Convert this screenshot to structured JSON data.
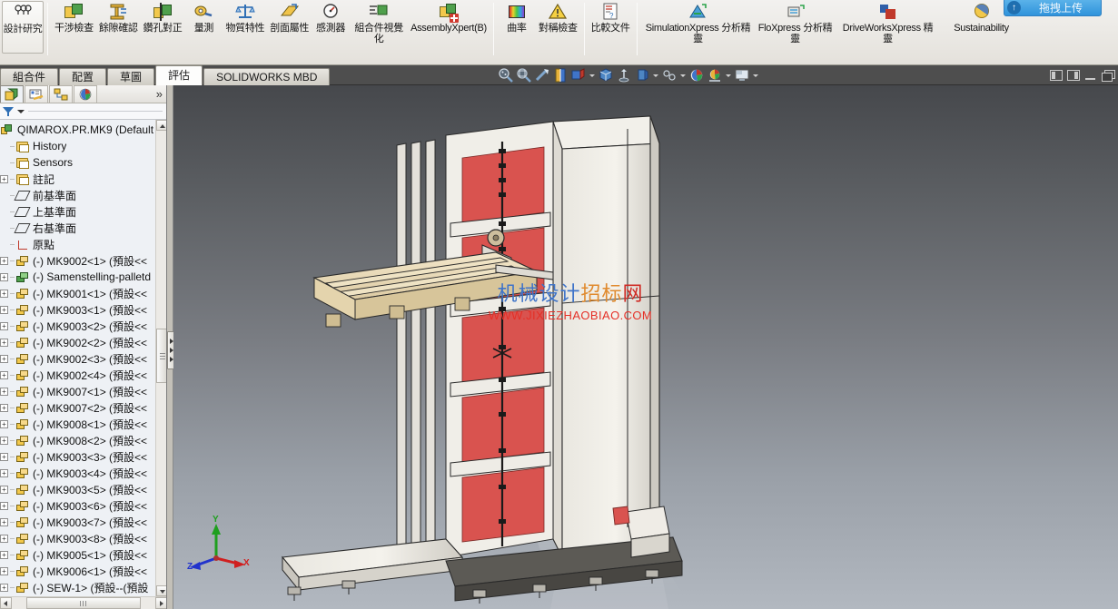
{
  "ribbon": {
    "first_button": {
      "name": "design-study",
      "label": "設計研究",
      "icon": "design-study-icon"
    },
    "groups": [
      {
        "items": [
          {
            "label": "干涉檢查",
            "icon": "interference-check-icon"
          },
          {
            "label": "餘隙確認",
            "icon": "clearance-verification-icon"
          },
          {
            "label": "鑽孔對正",
            "icon": "hole-alignment-icon"
          },
          {
            "label": "量測",
            "icon": "measure-icon"
          },
          {
            "label": "物質特性",
            "icon": "mass-properties-icon"
          },
          {
            "label": "剖面屬性",
            "icon": "section-properties-icon"
          },
          {
            "label": "感測器",
            "icon": "sensor-icon"
          },
          {
            "label": "組合件視覺化",
            "icon": "assembly-visualization-icon"
          },
          {
            "label": "AssemblyXpert(B)",
            "icon": "assembly-xpert-icon",
            "wide": true
          }
        ]
      },
      {
        "items": [
          {
            "label": "曲率",
            "icon": "curvature-icon"
          },
          {
            "label": "對稱檢查",
            "icon": "symmetry-check-icon"
          }
        ]
      },
      {
        "items": [
          {
            "label": "比較文件",
            "icon": "compare-documents-icon"
          }
        ]
      },
      {
        "items": [
          {
            "label": "SimulationXpress 分析精靈",
            "icon": "simulationxpress-icon",
            "wide": true
          },
          {
            "label": "FloXpress 分析精靈",
            "icon": "floxpress-icon",
            "wide": true
          },
          {
            "label": "DriveWorksXpress 精靈",
            "icon": "driveworksxpress-icon",
            "wide": true
          },
          {
            "label": "Sustainability",
            "icon": "sustainability-icon",
            "wide": true
          }
        ]
      }
    ]
  },
  "tabs": [
    {
      "label": "組合件",
      "active": false
    },
    {
      "label": "配置",
      "active": false
    },
    {
      "label": "草圖",
      "active": false
    },
    {
      "label": "評估",
      "active": true
    },
    {
      "label": "SOLIDWORKS MBD",
      "active": false
    }
  ],
  "view_toolbar": [
    {
      "name": "zoom-to-fit-icon"
    },
    {
      "name": "zoom-to-area-icon"
    },
    {
      "name": "previous-view-icon"
    },
    {
      "name": "section-view-icon"
    },
    {
      "name": "view-orientation-icon",
      "dropdown": true
    },
    {
      "name": "display-style-icon"
    },
    {
      "name": "hide-show-items-icon"
    },
    {
      "name": "edit-appearance-icon",
      "dropdown": true
    },
    {
      "name": "apply-scene-icon",
      "dropdown": true
    },
    {
      "name": "view-settings-icon"
    },
    {
      "name": "realview-graphics-icon",
      "dropdown": true
    },
    {
      "name": "viewport-layout-icon",
      "dropdown": true
    }
  ],
  "window_controls": [
    {
      "name": "dock-left-button"
    },
    {
      "name": "dock-right-button"
    },
    {
      "name": "minimize-button"
    },
    {
      "name": "restore-button"
    }
  ],
  "upload_widget": {
    "badge": "↑",
    "label": "拖拽上传"
  },
  "feature_manager": {
    "tabs": [
      {
        "name": "feature-manager-tab",
        "selected": true
      },
      {
        "name": "property-manager-tab",
        "selected": false
      },
      {
        "name": "configuration-manager-tab",
        "selected": false
      },
      {
        "name": "display-manager-tab",
        "selected": false
      }
    ],
    "expand_chevron": "»",
    "filter_placeholder": ""
  },
  "tree": {
    "root": {
      "label": "QIMAROX.PR.MK9  (Default",
      "icon": "assembly-icon",
      "expandable": false
    },
    "items": [
      {
        "label": "History",
        "icon": "history-folder-icon",
        "indent": 1,
        "expandable": false
      },
      {
        "label": "Sensors",
        "icon": "sensors-folder-icon",
        "indent": 1,
        "expandable": false
      },
      {
        "label": "註記",
        "icon": "annotations-folder-icon",
        "indent": 1,
        "expandable": true
      },
      {
        "label": "前基準面",
        "icon": "plane-icon",
        "indent": 1,
        "expandable": false
      },
      {
        "label": "上基準面",
        "icon": "plane-icon",
        "indent": 1,
        "expandable": false
      },
      {
        "label": "右基準面",
        "icon": "plane-icon",
        "indent": 1,
        "expandable": false
      },
      {
        "label": "原點",
        "icon": "origin-icon",
        "indent": 1,
        "expandable": false
      },
      {
        "label": "(-) MK9002<1> (預設<<",
        "icon": "part-icon",
        "indent": 1,
        "expandable": true
      },
      {
        "label": "(-) Samenstelling-palletd",
        "icon": "part-icon-green",
        "indent": 1,
        "expandable": true
      },
      {
        "label": "(-) MK9001<1> (預設<<",
        "icon": "part-icon",
        "indent": 1,
        "expandable": true
      },
      {
        "label": "(-) MK9003<1> (預設<<",
        "icon": "part-icon",
        "indent": 1,
        "expandable": true
      },
      {
        "label": "(-) MK9003<2> (預設<<",
        "icon": "part-icon",
        "indent": 1,
        "expandable": true
      },
      {
        "label": "(-) MK9002<2> (預設<<",
        "icon": "part-icon",
        "indent": 1,
        "expandable": true
      },
      {
        "label": "(-) MK9002<3> (預設<<",
        "icon": "part-icon",
        "indent": 1,
        "expandable": true
      },
      {
        "label": "(-) MK9002<4> (預設<<",
        "icon": "part-icon",
        "indent": 1,
        "expandable": true
      },
      {
        "label": "(-) MK9007<1> (預設<<",
        "icon": "part-icon",
        "indent": 1,
        "expandable": true
      },
      {
        "label": "(-) MK9007<2> (預設<<",
        "icon": "part-icon",
        "indent": 1,
        "expandable": true
      },
      {
        "label": "(-) MK9008<1> (預設<<",
        "icon": "part-icon",
        "indent": 1,
        "expandable": true
      },
      {
        "label": "(-) MK9008<2> (預設<<",
        "icon": "part-icon",
        "indent": 1,
        "expandable": true
      },
      {
        "label": "(-) MK9003<3> (預設<<",
        "icon": "part-icon",
        "indent": 1,
        "expandable": true
      },
      {
        "label": "(-) MK9003<4> (預設<<",
        "icon": "part-icon",
        "indent": 1,
        "expandable": true
      },
      {
        "label": "(-) MK9003<5> (預設<<",
        "icon": "part-icon",
        "indent": 1,
        "expandable": true
      },
      {
        "label": "(-) MK9003<6> (預設<<",
        "icon": "part-icon",
        "indent": 1,
        "expandable": true
      },
      {
        "label": "(-) MK9003<7> (預設<<",
        "icon": "part-icon",
        "indent": 1,
        "expandable": true
      },
      {
        "label": "(-) MK9003<8> (預設<<",
        "icon": "part-icon",
        "indent": 1,
        "expandable": true
      },
      {
        "label": "(-) MK9005<1> (預設<<",
        "icon": "part-icon",
        "indent": 1,
        "expandable": true
      },
      {
        "label": "(-) MK9006<1> (預設<<",
        "icon": "part-icon",
        "indent": 1,
        "expandable": true
      },
      {
        "label": "(-) SEW-1> (預設--(預設",
        "icon": "part-icon",
        "indent": 1,
        "expandable": true
      }
    ]
  },
  "viewport": {
    "watermark_line1_parts": [
      {
        "text": "机械设计",
        "color": "#3f74c9"
      },
      {
        "text": "招标",
        "color": "#e08a2e"
      },
      {
        "text": "网",
        "color": "#cf2b24"
      }
    ],
    "watermark_line2": "WWW.JIXIEZHAOBIAO.COM",
    "triad": {
      "x_label": "X",
      "x_color": "#d01f1f",
      "y_label": "Y",
      "y_color": "#1f9f1f",
      "z_label": "Z",
      "z_color": "#2233cc"
    },
    "background_top": "#46484c",
    "background_bottom": "#b2b8c0",
    "model_name": "qimarox-pallet-lift-assembly"
  }
}
